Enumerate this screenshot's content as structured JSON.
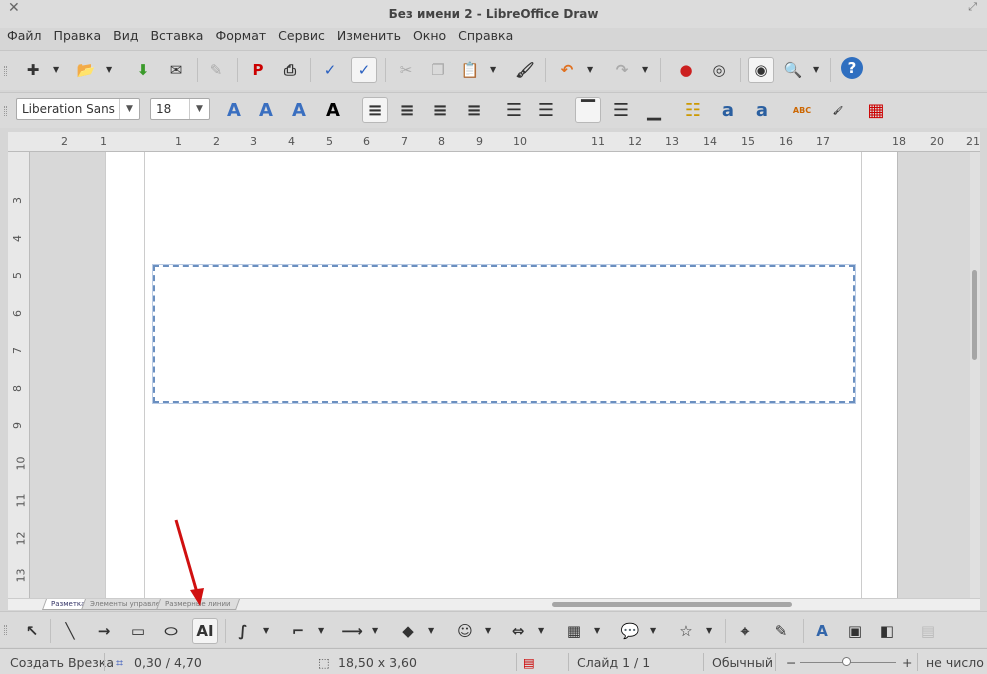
{
  "window": {
    "title": "Без имени 2 - LibreOffice Draw"
  },
  "menu": [
    "Файл",
    "Правка",
    "Вид",
    "Вставка",
    "Формат",
    "Сервис",
    "Изменить",
    "Окно",
    "Справка"
  ],
  "standard_toolbar": [
    "new-icon",
    "open-icon",
    "save-icon",
    "email-icon",
    "edit-file-icon",
    "export-pdf-icon",
    "print-icon",
    "spellcheck-icon",
    "autospellcheck-icon",
    "cut-icon",
    "copy-icon",
    "paste-icon",
    "clone-formatting-icon",
    "undo-icon",
    "redo-icon",
    "gallery-icon",
    "navigator-icon",
    "zoom-pan-icon",
    "zoom-icon",
    "help-icon"
  ],
  "format_toolbar": {
    "font": "Liberation Sans",
    "size": "18"
  },
  "ruler": {
    "h": [
      "2",
      "1",
      "1",
      "2",
      "3",
      "4",
      "5",
      "6",
      "7",
      "8",
      "9",
      "10",
      "11",
      "12",
      "13",
      "14",
      "15",
      "16",
      "17",
      "18",
      "20",
      "21",
      "2"
    ],
    "v": [
      "3",
      "4",
      "5",
      "6",
      "7",
      "8",
      "9",
      "10",
      "11",
      "12",
      "13"
    ]
  },
  "layer_tabs": [
    "Разметка",
    "Элементы управления",
    "Размерные линии"
  ],
  "drawing_toolbar": [
    "select-icon",
    "line-icon",
    "arrow-line-icon",
    "rectangle-icon",
    "ellipse-icon",
    "text-icon",
    "curve-icon",
    "connector-icon",
    "lines-arrows-icon",
    "basic-shapes-icon",
    "symbol-shapes-icon",
    "block-arrows-icon",
    "flowchart-icon",
    "callouts-icon",
    "stars-icon",
    "points-icon",
    "glue-points-icon",
    "fontwork-icon",
    "from-file-icon",
    "shadow-icon",
    "extrusion-icon"
  ],
  "status": {
    "action": "Создать Врезка",
    "position": "0,30 / 4,70",
    "size": "18,50 x 3,60",
    "slide": "Слайд 1 / 1",
    "layout": "Обычный",
    "zoom_minus": "−",
    "zoom_plus": "+",
    "zoom_value": "не число"
  },
  "colors": {
    "accent": "#6a8fc0",
    "annotation_arrow": "#d01010"
  }
}
